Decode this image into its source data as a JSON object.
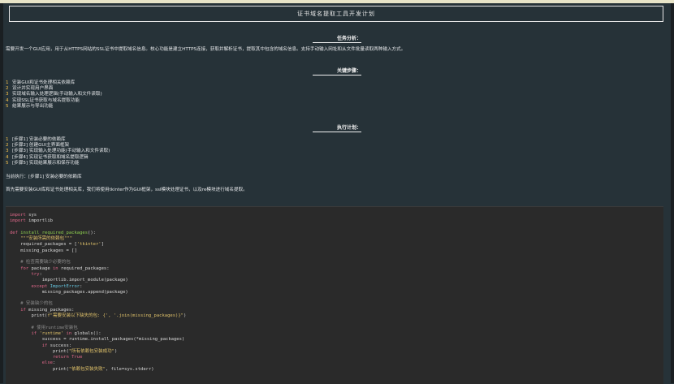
{
  "title": "证书域名提取工具开发计划",
  "task_heading": "任务分析：",
  "task_text": "需要开发一个GUI应用，用于从HTTPS网站的SSL证书中提取域名信息。核心功能是建立HTTPS连接，获取并解析证书，提取其中包含的域名信息。支持手动输入网址和从文件批量读取两种输入方式。",
  "steps_heading": "关键步骤：",
  "steps": [
    {
      "num": "1",
      "text": "安装GUI和证书处理相关依赖库"
    },
    {
      "num": "2",
      "text": "设计并实现用户界面"
    },
    {
      "num": "3",
      "text": "实现域名输入处理逻辑(手动输入和文件读取)"
    },
    {
      "num": "4",
      "text": "实现SSL证书获取与域名提取功能"
    },
    {
      "num": "5",
      "text": "结果展示与导出功能"
    }
  ],
  "plan_heading": "执行计划：",
  "plan": [
    {
      "num": "1",
      "text": "[步骤1] 安装必要的依赖库"
    },
    {
      "num": "2",
      "text": "[步骤2] 创建GUI主界面框架"
    },
    {
      "num": "3",
      "text": "[步骤3] 实现输入处理功能(手动输入和文件读取)"
    },
    {
      "num": "4",
      "text": "[步骤4] 实现证书获取和域名提取逻辑"
    },
    {
      "num": "5",
      "text": "[步骤5] 实现结果展示和保存功能"
    }
  ],
  "current_exec": "当前执行：[步骤1] 安装必要的依赖库",
  "exec_desc": "首先需要安装GUI库和证书处理相关库，我们将使用tkinter作为GUI框架，ssl模块处理证书，以及re模块进行域名提取。",
  "code": {
    "l1a": "import",
    "l1b": " sys",
    "l2a": "import",
    "l2b": " importlib",
    "l4a": "def ",
    "l4b": "install_required_packages",
    "l4c": "():",
    "l5": "    \"\"\"安装所需的依赖包\"\"\"",
    "l6a": "    required_packages = [",
    "l6b": "'tkinter'",
    "l6c": "]",
    "l7": "    missing_packages = []",
    "l9": "    # 检查需要缺少必要的包",
    "l10a": "    for",
    "l10b": " package ",
    "l10c": "in",
    "l10d": " required_packages:",
    "l11a": "        try",
    "l11b": ":",
    "l12": "            importlib.import_module(package)",
    "l13a": "        except ",
    "l13b": "ImportError",
    "l13c": ":",
    "l14": "            missing_packages.append(package)",
    "l16": "    # 安装缺少的包",
    "l17a": "    if",
    "l17b": " missing_packages:",
    "l18a": "        print(",
    "l18b": "f\"需要安装以下缺失的包: {', '.join(missing_packages)}\"",
    "l18c": ")",
    "l20": "        # 使用runtime安装包",
    "l21a": "        if ",
    "l21b": "'runtime'",
    "l21c": " in",
    "l21d": " globals():",
    "l22": "            success = runtime.install_packages(*missing_packages)",
    "l23a": "            if",
    "l23b": " success:",
    "l24a": "                print(",
    "l24b": "\"所有依赖包安装成功\"",
    "l24c": ")",
    "l25a": "                return",
    "l25b": " True",
    "l26a": "            else",
    "l26b": ":",
    "l27a": "                print(",
    "l27b": "\"依赖包安装失败\"",
    "l27c": ", file=sys.stderr)"
  }
}
